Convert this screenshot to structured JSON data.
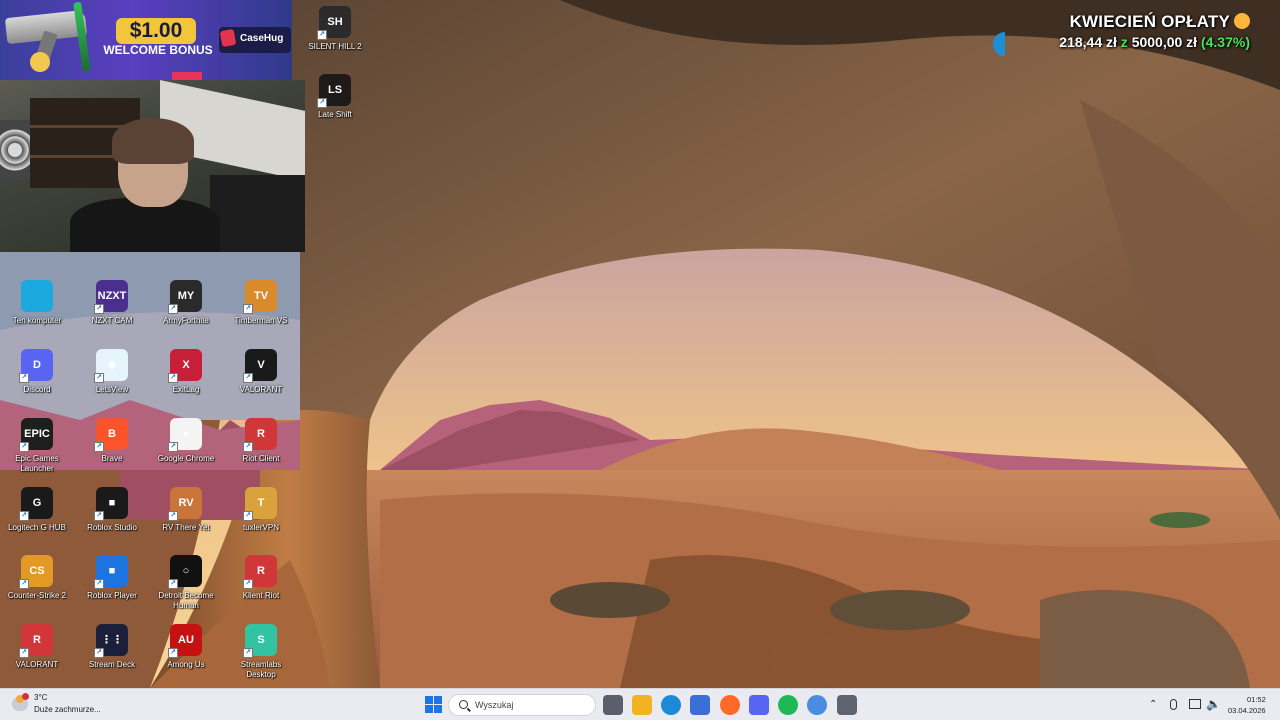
{
  "overlays": {
    "promo": {
      "amount": "$1.00",
      "bonus_label": "WELCOME BONUS",
      "brand": "CaseHug"
    },
    "payout": {
      "title": "KWIECIEŃ OPŁATY",
      "current": "218,44 zł",
      "separator": "z",
      "goal": "5000,00 zł",
      "percent": "(4.37%)"
    }
  },
  "desktop": {
    "icons_top": [
      {
        "label": "SILENT HILL 2",
        "color": "#2b2b2b",
        "glyph": "SH"
      },
      {
        "label": "Late Shift",
        "color": "#1f1a1a",
        "glyph": "LS"
      }
    ],
    "icons_grid": [
      {
        "label": "Ten komputer",
        "color": "#1ba9e0",
        "glyph": ""
      },
      {
        "label": "NZXT CAM",
        "color": "#4b2f8f",
        "glyph": "NZXT"
      },
      {
        "label": "ArmyForthite",
        "color": "#2a2a2a",
        "glyph": "MY"
      },
      {
        "label": "Timberman VS",
        "color": "#d98a2b",
        "glyph": "TV"
      },
      {
        "label": "Discord",
        "color": "#5865f2",
        "glyph": "D"
      },
      {
        "label": "LetsView",
        "color": "#e6f4fb",
        "glyph": "◆"
      },
      {
        "label": "ExitLag",
        "color": "#c71f37",
        "glyph": "X"
      },
      {
        "label": "VALORANT",
        "color": "#1a1a1a",
        "glyph": "V"
      },
      {
        "label": "Epic Games Launcher",
        "color": "#1e1e1e",
        "glyph": "EPIC"
      },
      {
        "label": "Brave",
        "color": "#fb542b",
        "glyph": "B"
      },
      {
        "label": "Google Chrome",
        "color": "#f4f4f4",
        "glyph": "●"
      },
      {
        "label": "Riot Client",
        "color": "#d13639",
        "glyph": "R"
      },
      {
        "label": "Logitech G HUB",
        "color": "#1a1a1a",
        "glyph": "G"
      },
      {
        "label": "Roblox Studio",
        "color": "#1a1a1a",
        "glyph": "■"
      },
      {
        "label": "RV There Yet",
        "color": "#c9753a",
        "glyph": "RV"
      },
      {
        "label": "tuxlerVPN",
        "color": "#d9a23a",
        "glyph": "T"
      },
      {
        "label": "Counter-Strike 2",
        "color": "#e39a24",
        "glyph": "CS"
      },
      {
        "label": "Roblox Player",
        "color": "#1d74e0",
        "glyph": "■"
      },
      {
        "label": "Detroit Become Human",
        "color": "#111111",
        "glyph": "○"
      },
      {
        "label": "Klient Riot",
        "color": "#d13639",
        "glyph": "R"
      },
      {
        "label": "VALORANT",
        "color": "#d13639",
        "glyph": "R"
      },
      {
        "label": "Stream Deck",
        "color": "#1a1f3a",
        "glyph": "⋮⋮"
      },
      {
        "label": "Among Us",
        "color": "#c51111",
        "glyph": "AU"
      },
      {
        "label": "Streamlabs Desktop",
        "color": "#31c3a2",
        "glyph": "S"
      }
    ]
  },
  "taskbar": {
    "weather": {
      "temp": "3°C",
      "condition": "Duże zachmurze..."
    },
    "search_placeholder": "Wyszukaj",
    "apps": [
      {
        "name": "task-view",
        "color": "#5a5f6b"
      },
      {
        "name": "file-explorer",
        "color": "#f2b320"
      },
      {
        "name": "edge",
        "color": "#1c8ad6"
      },
      {
        "name": "microsoft-store",
        "color": "#3b6fd8"
      },
      {
        "name": "firefox",
        "color": "#ff6a2b"
      },
      {
        "name": "discord",
        "color": "#5865f2"
      },
      {
        "name": "spotify",
        "color": "#1db954"
      },
      {
        "name": "chrome",
        "color": "#4a8de0"
      },
      {
        "name": "settings",
        "color": "#5d6470"
      }
    ],
    "clock": {
      "time": "01:52",
      "date": "03.04.2026"
    }
  }
}
